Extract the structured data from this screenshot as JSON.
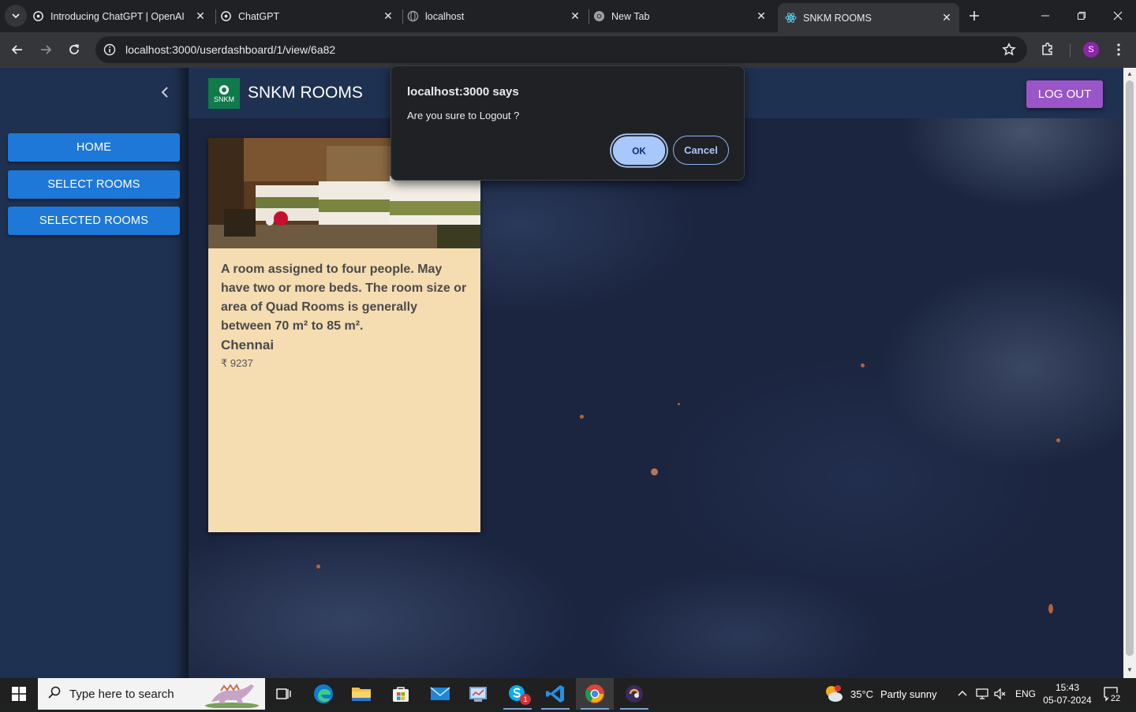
{
  "browser": {
    "tabs": [
      {
        "title": "Introducing ChatGPT | OpenAI",
        "icon": "openai-icon"
      },
      {
        "title": "ChatGPT",
        "icon": "openai-icon"
      },
      {
        "title": "localhost",
        "icon": "globe-icon"
      },
      {
        "title": "New Tab",
        "icon": "chrome-icon"
      },
      {
        "title": "SNKM ROOMS",
        "icon": "react-icon",
        "active": true
      }
    ],
    "url": "localhost:3000/userdashboard/1/view/6a82",
    "profile_initial": "S"
  },
  "app": {
    "logo_text": "SNKM",
    "brand": "SNKM ROOMS",
    "logout_label": "LOG OUT",
    "sidebar": {
      "items": [
        {
          "label": "HOME"
        },
        {
          "label": "SELECT ROOMS"
        },
        {
          "label": "SELECTED ROOMS"
        }
      ]
    },
    "room": {
      "description": "A room assigned to four people. May have two or more beds. The room size or area of Quad Rooms is generally between 70 m² to 85 m².",
      "city": "Chennai",
      "price": "₹ 9237"
    }
  },
  "dialog": {
    "title": "localhost:3000 says",
    "message": "Are you sure to Logout ?",
    "ok_label": "OK",
    "cancel_label": "Cancel"
  },
  "taskbar": {
    "search_placeholder": "Type here to search",
    "weather": "35°C",
    "weather_desc": "Partly sunny",
    "language": "ENG",
    "time": "15:43",
    "date": "05-07-2024",
    "notifications": "22",
    "skype_badge": "1"
  },
  "colors": {
    "sidebar_bg": "#1f3150",
    "nav_button": "#1e78d8",
    "logout_button": "#9a55c8",
    "card_bg": "#f5dcb1",
    "dialog_bg": "#202124",
    "dialog_accent": "#a8c7fa"
  }
}
